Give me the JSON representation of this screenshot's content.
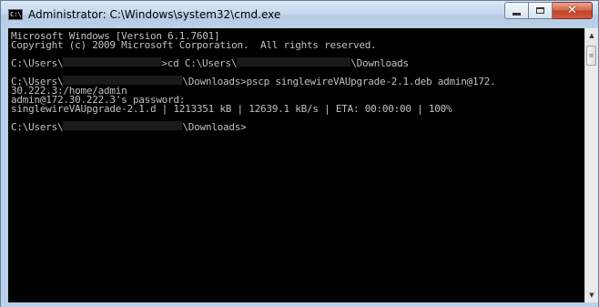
{
  "window": {
    "title": "Administrator: C:\\Windows\\system32\\cmd.exe",
    "icon": "console-icon",
    "icon_text": "C:\\"
  },
  "caption_buttons": {
    "minimize": "minimize-icon",
    "maximize": "maximize-icon",
    "close": "close-icon",
    "close_glyph": "✕"
  },
  "console": {
    "background": "#000000",
    "foreground": "#c0c0c0",
    "lines": [
      {
        "parts": [
          "Microsoft Windows [Version 6.1.7601]"
        ]
      },
      {
        "parts": [
          "Copyright (c) 2009 Microsoft Corporation.  All rights reserved."
        ]
      },
      {
        "parts": [
          ""
        ]
      },
      {
        "parts": [
          "C:\\Users\\",
          "",
          ">cd C:\\Users\\",
          "",
          "\\Downloads"
        ],
        "redacted": [
          1,
          3
        ]
      },
      {
        "parts": [
          ""
        ]
      },
      {
        "parts": [
          "C:\\Users\\",
          "",
          "\\Downloads>pscp singlewireVAUpgrade-2.1.deb admin@172."
        ],
        "redacted": [
          1
        ]
      },
      {
        "parts": [
          "30.222.3:/home/admin"
        ]
      },
      {
        "parts": [
          "admin@172.30.222.3's password:"
        ]
      },
      {
        "parts": [
          "singlewireVAUpgrade-2.1.d | 1213351 kB | 12639.1 kB/s | ETA: 00:00:00 | 100%"
        ]
      },
      {
        "parts": [
          ""
        ]
      },
      {
        "parts": [
          "C:\\Users\\",
          "",
          "\\Downloads>"
        ],
        "redacted": [
          1
        ]
      }
    ]
  },
  "scrollbar": {
    "up_arrow": "▲",
    "down_arrow": "▼",
    "thumb_grip": "≡"
  }
}
